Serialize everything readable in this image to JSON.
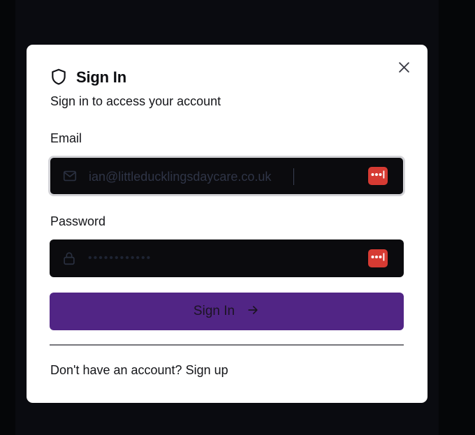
{
  "modal": {
    "title": "Sign In",
    "subtitle": "Sign in to access your account",
    "header_icon": "shield-icon",
    "close_icon": "close-icon"
  },
  "form": {
    "email": {
      "label": "Email",
      "value": "ian@littleducklingsdaycare.co.uk",
      "icon": "mail-icon",
      "password_manager_icon": "password-manager-icon"
    },
    "password": {
      "label": "Password",
      "value": "••••••••••••",
      "icon": "lock-icon",
      "password_manager_icon": "password-manager-icon"
    },
    "submit": {
      "label": "Sign In",
      "icon": "arrow-right-icon"
    }
  },
  "footer": {
    "prompt": "Don't have an account?",
    "link_label": "Sign up"
  },
  "colors": {
    "primary": "#512585",
    "input_background": "#0b0b0e",
    "password_manager_accent": "#d63b33",
    "page_background": "#0a0b10"
  }
}
